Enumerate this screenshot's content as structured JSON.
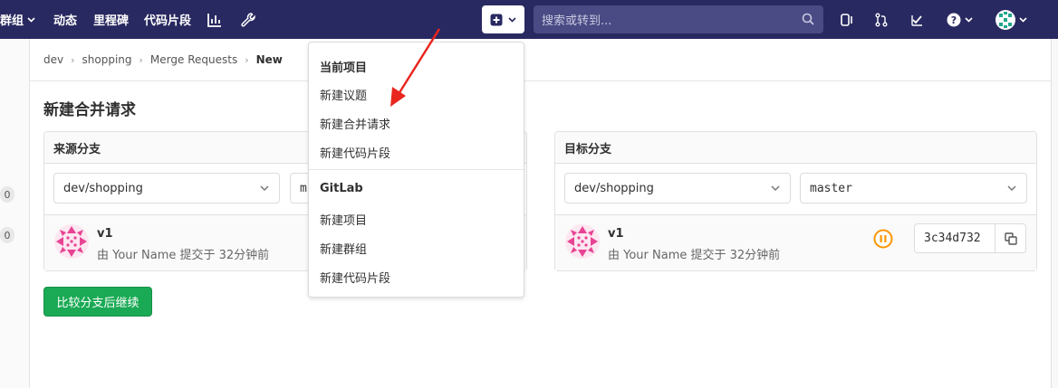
{
  "navbar": {
    "items": [
      "群组",
      "动态",
      "里程碑",
      "代码片段"
    ],
    "search_placeholder": "搜索或转到...",
    "icons": [
      "chart-icon",
      "wrench-icon",
      "plus-square-icon",
      "search-icon",
      "issues-icon",
      "merge-request-icon",
      "todo-icon",
      "help-icon",
      "user-avatar"
    ]
  },
  "breadcrumb": {
    "items": [
      "dev",
      "shopping",
      "Merge Requests"
    ],
    "current": "New"
  },
  "page": {
    "title": "新建合并请求",
    "compare_button": "比较分支后继续"
  },
  "sidebar": {
    "badges": [
      "0",
      "0"
    ]
  },
  "source": {
    "header": "来源分支",
    "project": "dev/shopping",
    "branch_partial": "m",
    "commit": {
      "title": "v1",
      "meta": "由 Your Name 提交于 32分钟前"
    }
  },
  "target": {
    "header": "目标分支",
    "project": "dev/shopping",
    "branch": "master",
    "commit": {
      "title": "v1",
      "meta": "由 Your Name 提交于 32分钟前",
      "sha": "3c34d732"
    }
  },
  "dropdown": {
    "section1_header": "当前项目",
    "section1_items": [
      "新建议题",
      "新建合并请求",
      "新建代码片段"
    ],
    "section2_header": "GitLab",
    "section2_items": [
      "新建项目",
      "新建群组",
      "新建代码片段"
    ]
  },
  "colors": {
    "navbar": "#292961",
    "search": "#4a4a85",
    "primary_button": "#1aaa55",
    "pipeline_icon": "#fc9403",
    "annotation_arrow": "#e8261e",
    "avatar": "#e84393"
  }
}
